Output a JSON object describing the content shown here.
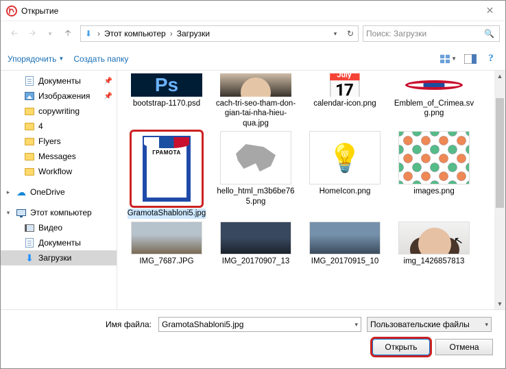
{
  "title": "Открытие",
  "path": {
    "root": "Этот компьютер",
    "folder": "Загрузки"
  },
  "search": {
    "placeholder": "Поиск: Загрузки"
  },
  "toolbar": {
    "organize": "Упорядочить",
    "newfolder": "Создать папку"
  },
  "tree": {
    "quick": [
      {
        "label": "Документы",
        "icon": "doc",
        "pinned": true
      },
      {
        "label": "Изображения",
        "icon": "img",
        "pinned": true
      },
      {
        "label": "copywriting",
        "icon": "folder"
      },
      {
        "label": "4",
        "icon": "folder"
      },
      {
        "label": "Flyers",
        "icon": "folder"
      },
      {
        "label": "Messages",
        "icon": "folder"
      },
      {
        "label": "Workflow",
        "icon": "folder"
      }
    ],
    "onedrive": "OneDrive",
    "thispc": "Этот компьютер",
    "pc": [
      {
        "label": "Видео",
        "icon": "video"
      },
      {
        "label": "Документы",
        "icon": "doc"
      },
      {
        "label": "Загрузки",
        "icon": "download",
        "selected": true
      }
    ]
  },
  "files": {
    "row1": [
      {
        "label": "bootstrap-1170.psd",
        "thumb": "ps"
      },
      {
        "label": "cach-tri-seo-tham-don-gian-tai-nha-hieu-qua.jpg",
        "thumb": "face1"
      },
      {
        "label": "calendar-icon.png",
        "thumb": "cal"
      },
      {
        "label": "Emblem_of_Crimea.svg.png",
        "thumb": "emblem"
      }
    ],
    "row2": [
      {
        "label": "GramotaShabloni5.jpg",
        "thumb": "gramota",
        "selected": true
      },
      {
        "label": "hello_html_m3b6be765.png",
        "thumb": "crimea"
      },
      {
        "label": "HomeIcon.png",
        "thumb": "bulb"
      },
      {
        "label": "images.png",
        "thumb": "icons"
      }
    ],
    "row3": [
      {
        "label": "IMG_7687.JPG",
        "thumb": "photo1"
      },
      {
        "label": "IMG_20170907_13",
        "thumb": "photo2"
      },
      {
        "label": "IMG_20170915_10",
        "thumb": "photo3"
      },
      {
        "label": "img_1426857813",
        "thumb": "face2"
      }
    ]
  },
  "bottom": {
    "filename_label": "Имя файла:",
    "filename_value": "GramotaShabloni5.jpg",
    "filter": "Пользовательские файлы",
    "open": "Открыть",
    "cancel": "Отмена"
  }
}
